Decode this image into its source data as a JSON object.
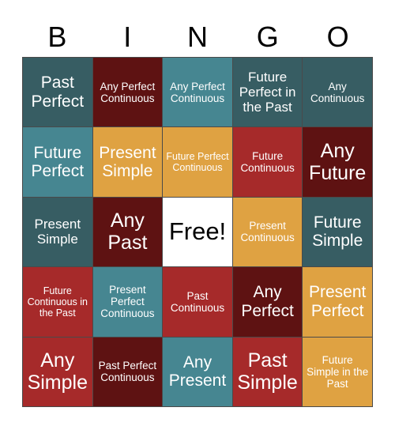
{
  "header": {
    "letters": [
      "B",
      "I",
      "N",
      "G",
      "O"
    ]
  },
  "palette": {
    "dark_teal": "#375d63",
    "light_teal": "#468691",
    "dark_maroon": "#5e1212",
    "brick_red": "#a62a2a",
    "gold": "#dfa242",
    "free_white": "#ffffff",
    "grid_line": "#4a4a4a",
    "page_background": "#ffffff",
    "header_text": "#000000",
    "cell_text": "#ffffff"
  },
  "grid": {
    "rows": 5,
    "columns": 5,
    "cells": [
      {
        "label": "Past Perfect",
        "color": "#375d63",
        "size": "lg",
        "free": false
      },
      {
        "label": "Any Perfect Continuous",
        "color": "#5e1212",
        "size": "sm",
        "free": false
      },
      {
        "label": "Any Perfect Continuous",
        "color": "#468691",
        "size": "sm",
        "free": false
      },
      {
        "label": "Future Perfect in the Past",
        "color": "#375d63",
        "size": "md",
        "free": false
      },
      {
        "label": "Any Continuous",
        "color": "#375d63",
        "size": "sm",
        "free": false
      },
      {
        "label": "Future Perfect",
        "color": "#468691",
        "size": "lg",
        "free": false
      },
      {
        "label": "Present Simple",
        "color": "#dfa242",
        "size": "lg",
        "free": false
      },
      {
        "label": "Future Perfect Continuous",
        "color": "#dfa242",
        "size": "xs",
        "free": false
      },
      {
        "label": "Future Continuous",
        "color": "#a62a2a",
        "size": "sm",
        "free": false
      },
      {
        "label": "Any Future",
        "color": "#5e1212",
        "size": "xl",
        "free": false
      },
      {
        "label": "Present Simple",
        "color": "#375d63",
        "size": "md",
        "free": false
      },
      {
        "label": "Any Past",
        "color": "#5e1212",
        "size": "xl",
        "free": false
      },
      {
        "label": "Free!",
        "color": "#ffffff",
        "size": "xl",
        "free": true
      },
      {
        "label": "Present Continuous",
        "color": "#dfa242",
        "size": "sm",
        "free": false
      },
      {
        "label": "Future Simple",
        "color": "#375d63",
        "size": "lg",
        "free": false
      },
      {
        "label": "Future Continuous in the Past",
        "color": "#a62a2a",
        "size": "xs",
        "free": false
      },
      {
        "label": "Present Perfect Continuous",
        "color": "#468691",
        "size": "sm",
        "free": false
      },
      {
        "label": "Past Continuous",
        "color": "#a62a2a",
        "size": "sm",
        "free": false
      },
      {
        "label": "Any Perfect",
        "color": "#5e1212",
        "size": "lg",
        "free": false
      },
      {
        "label": "Present Perfect",
        "color": "#dfa242",
        "size": "lg",
        "free": false
      },
      {
        "label": "Any Simple",
        "color": "#a62a2a",
        "size": "xl",
        "free": false
      },
      {
        "label": "Past Perfect Continuous",
        "color": "#5e1212",
        "size": "sm",
        "free": false
      },
      {
        "label": "Any Present",
        "color": "#468691",
        "size": "lg",
        "free": false
      },
      {
        "label": "Past Simple",
        "color": "#a62a2a",
        "size": "xl",
        "free": false
      },
      {
        "label": "Future Simple in the Past",
        "color": "#dfa242",
        "size": "sm",
        "free": false
      }
    ]
  }
}
